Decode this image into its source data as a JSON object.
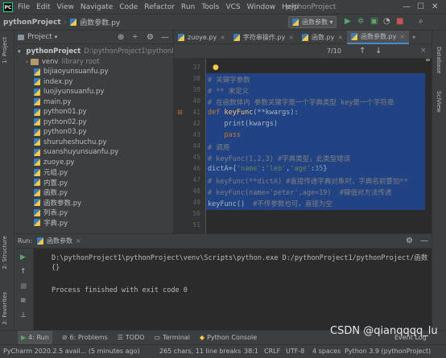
{
  "menubar": {
    "items": [
      "File",
      "Edit",
      "View",
      "Navigate",
      "Code",
      "Refactor",
      "Run",
      "Tools",
      "VCS",
      "Window",
      "Help"
    ],
    "window_title": "pythonProject"
  },
  "navbar": {
    "project": "pythonProject",
    "file": "函数参数.py",
    "run_config": "函数参数"
  },
  "project_panel": {
    "title": "Project",
    "root_label": "pythonProject",
    "root_path": "D:\\pythonProject1\\pythonPro",
    "venv_label": "venv",
    "venv_note": "library root",
    "files": [
      "bijiaoyunsuanfu.py",
      "index.py",
      "luojiyunsuanfu.py",
      "main.py",
      "python01.py",
      "python02.py",
      "python03.py",
      "shuruheshuchu.py",
      "suanshuyunsuanfu.py",
      "zuoye.py",
      "元组.py",
      "内置.py",
      "函数.py",
      "函数参数.py",
      "列表.py",
      "字典.py"
    ]
  },
  "editor": {
    "tabs": [
      "zuoye.py",
      "字符串操作.py",
      "函数.py",
      "函数参数.py"
    ],
    "active_tab": "函数参数.py",
    "find_count": "7/10",
    "line_numbers": [
      "37",
      "38",
      "39",
      "40",
      "41",
      "42",
      "43",
      "44",
      "45",
      "46",
      "47",
      "48",
      "49",
      "50",
      "51"
    ],
    "lines": {
      "l38": "# 关键字参数",
      "l39": "# ** 来定义",
      "l40": "# 在函数体内 参数关键字是一个字典类型 key是一个字符串",
      "l41_kw": "def ",
      "l41_fn": "keyFunc",
      "l41_rest": "(**kwargs):",
      "l42": "    print(kwargs)",
      "l43": "    pass",
      "l44": "# 调用",
      "l45": "# keyFunc(1,2,3) #字典类型，此类型错误",
      "l46_a": "dictA={",
      "l46_s1": "'name'",
      "l46_b": ":",
      "l46_s2": "'leo'",
      "l46_c": ",",
      "l46_s3": "'age'",
      "l46_d": ":",
      "l46_n": "35",
      "l46_e": "}",
      "l47": "# keyFunc(**dictA) #直接传递字典对象时，字典名前要加**",
      "l48": "# keyFunc(name='peter',age=19)  #键值对方法传递",
      "l49_code": "keyFunc()",
      "l49_com": "  #不传参数也可，直接为空"
    }
  },
  "run_panel": {
    "label": "Run:",
    "tab": "函数参数",
    "output": [
      "D:\\pythonProject1\\pythonProject\\venv\\Scripts\\python.exe D:/pythonProject1/pythonProject/函数",
      "{}",
      "",
      "Process finished with exit code 0"
    ]
  },
  "bottom_tabs": [
    "4: Run",
    "6: Problems",
    "TODO",
    "Terminal",
    "Python Console",
    "Event Log"
  ],
  "side_tabs": {
    "left": [
      "1: Project",
      "2: Structure",
      "2: Favorites"
    ],
    "right": [
      "Database",
      "SciView"
    ]
  },
  "statusbar": {
    "left": "PyCharm 2020.2.5 avail... (5 minutes ago)",
    "chars": "265 chars, 11 line breaks",
    "pos": "38:1",
    "crlf": "CRLF",
    "enc": "UTF-8",
    "indent": "4 spaces",
    "python": "Python 3.9 (pythonProject)"
  },
  "watermark": "CSDN @qianqqqq_lu"
}
